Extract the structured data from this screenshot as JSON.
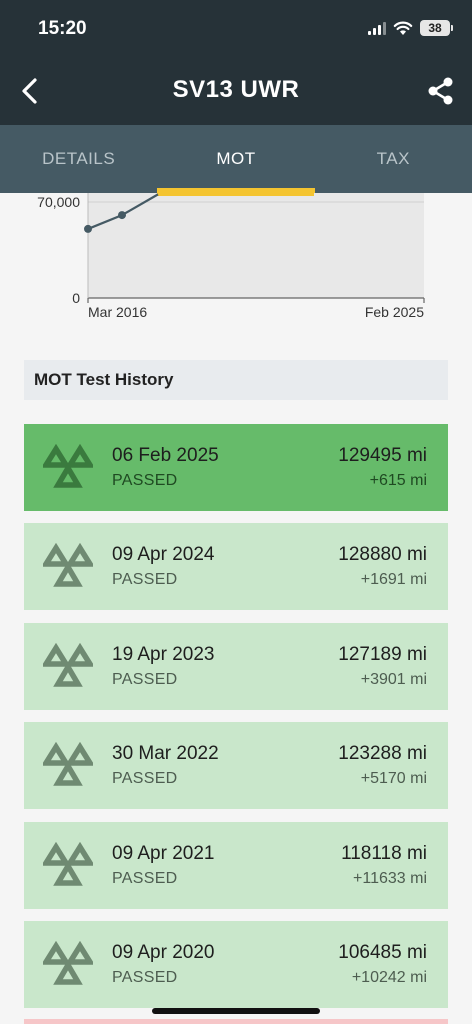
{
  "status_bar": {
    "time": "15:20",
    "battery": "38"
  },
  "app_bar": {
    "title": "SV13 UWR"
  },
  "tabs": [
    {
      "label": "DETAILS",
      "active": false
    },
    {
      "label": "MOT",
      "active": true
    },
    {
      "label": "TAX",
      "active": false
    }
  ],
  "chart_data": {
    "type": "line",
    "x": [
      "Mar 2016",
      "Mar 2017",
      "Mar 2018"
    ],
    "values": [
      50000,
      60000,
      75000
    ],
    "y_ticks": [
      "70,000",
      "0"
    ],
    "x_ticks": [
      "Mar 2016",
      "Feb 2025"
    ],
    "ylim": [
      0,
      76000
    ],
    "colors": {
      "line": "#455a64",
      "plot_bg": "#e8e8e8"
    }
  },
  "section": {
    "title": "MOT Test History"
  },
  "mot_history": [
    {
      "date": "06 Feb 2025",
      "status": "PASSED",
      "mileage": "129495 mi",
      "diff": "+615 mi",
      "latest": true
    },
    {
      "date": "09 Apr 2024",
      "status": "PASSED",
      "mileage": "128880 mi",
      "diff": "+1691 mi",
      "latest": false
    },
    {
      "date": "19 Apr 2023",
      "status": "PASSED",
      "mileage": "127189 mi",
      "diff": "+3901 mi",
      "latest": false
    },
    {
      "date": "30 Mar 2022",
      "status": "PASSED",
      "mileage": "123288 mi",
      "diff": "+5170 mi",
      "latest": false
    },
    {
      "date": "09 Apr 2021",
      "status": "PASSED",
      "mileage": "118118 mi",
      "diff": "+11633 mi",
      "latest": false
    },
    {
      "date": "09 Apr 2020",
      "status": "PASSED",
      "mileage": "106485 mi",
      "diff": "+10242 mi",
      "latest": false
    }
  ],
  "icons": {
    "back": "chevron-left-icon",
    "share": "share-icon",
    "mot": "mot-triangles-icon"
  },
  "colors": {
    "header": "#263238",
    "tabs": "#455a64",
    "tab_indicator": "#f4c430",
    "passed_latest": "#66bb6a",
    "passed": "#c9e7cb"
  }
}
